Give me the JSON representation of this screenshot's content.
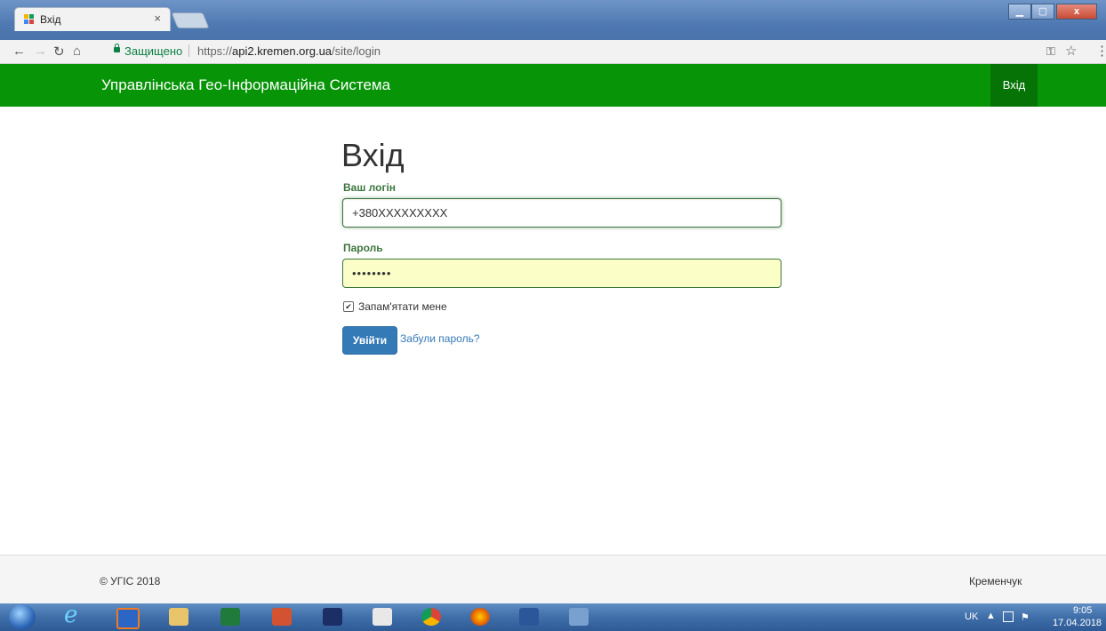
{
  "browser": {
    "tab_title": "Вхід",
    "tab_close": "×",
    "secure_label": "Защищено",
    "url_scheme": "https://",
    "url_host": "api2.kremen.org.ua",
    "url_path": "/site/login"
  },
  "navbar": {
    "brand": "Управлінська Гео-Інформаційна Система",
    "login_link": "Вхід"
  },
  "form": {
    "title": "Вхід",
    "login_label": "Ваш логін",
    "login_value": "+380XXXXXXXXX",
    "password_label": "Пароль",
    "password_value": "••••••••",
    "remember_label": "Запам'ятати мене",
    "remember_checked": true,
    "submit_label": "Увійти",
    "forgot_label": "Забули пароль?"
  },
  "footer": {
    "copyright": "© УГІС 2018",
    "city": "Кременчук"
  },
  "taskbar": {
    "language": "UK",
    "time": "9:05",
    "date": "17.04.2018",
    "apps": [
      "internet-explorer",
      "media-player",
      "file-explorer",
      "excel",
      "powerpoint",
      "save-disk",
      "solitaire",
      "chrome",
      "firefox",
      "word",
      "messenger"
    ]
  },
  "colors": {
    "navbar": "#079407",
    "navbar_active": "#067306",
    "primary": "#337ab7",
    "success_label": "#3c763d",
    "autofill": "#fbffc7"
  }
}
